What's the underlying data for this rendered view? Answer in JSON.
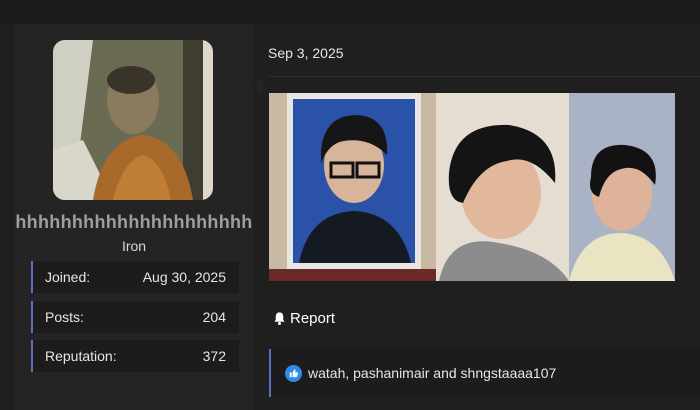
{
  "user": {
    "username": "hhhhhhhhhhhhhhhhhhhhh",
    "rank": "Iron",
    "stats": [
      {
        "label": "Joined:",
        "value": "Aug 30, 2025"
      },
      {
        "label": "Posts:",
        "value": "204"
      },
      {
        "label": "Reputation:",
        "value": "372"
      }
    ]
  },
  "post": {
    "date": "Sep 3, 2025",
    "report_label": "Report",
    "reactions_text": "watah, pashanimair and shngstaaaa107"
  },
  "colors": {
    "accent": "#5b6fc7",
    "like_blue": "#2f8be8"
  },
  "icons": {
    "report": "bell-icon",
    "reaction": "like-icon"
  }
}
